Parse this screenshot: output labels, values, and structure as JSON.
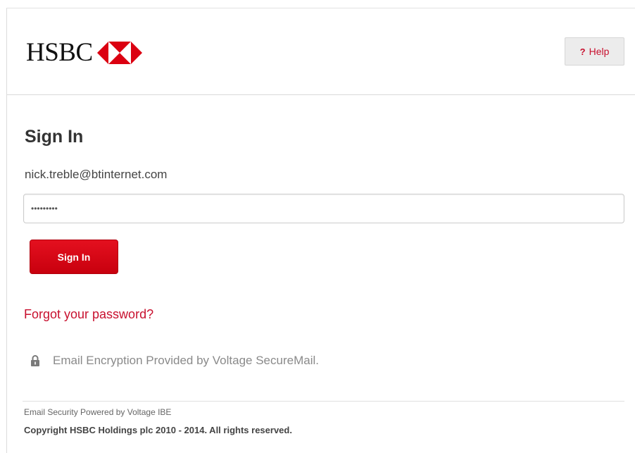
{
  "header": {
    "logo_text": "HSBC",
    "brand_color": "#db0011",
    "help_icon": "?",
    "help_label": "Help"
  },
  "signin": {
    "title": "Sign In",
    "email": "nick.treble@btinternet.com",
    "password_masked": "•••••••••",
    "button_label": "Sign In"
  },
  "forgot_password_label": "Forgot your password?",
  "encryption": {
    "icon": "lock-icon",
    "text": "Email Encryption Provided by Voltage SecureMail."
  },
  "footer": {
    "powered_by": "Email Security Powered by Voltage IBE",
    "copyright": "Copyright HSBC Holdings plc 2010 - 2014. All rights reserved."
  }
}
